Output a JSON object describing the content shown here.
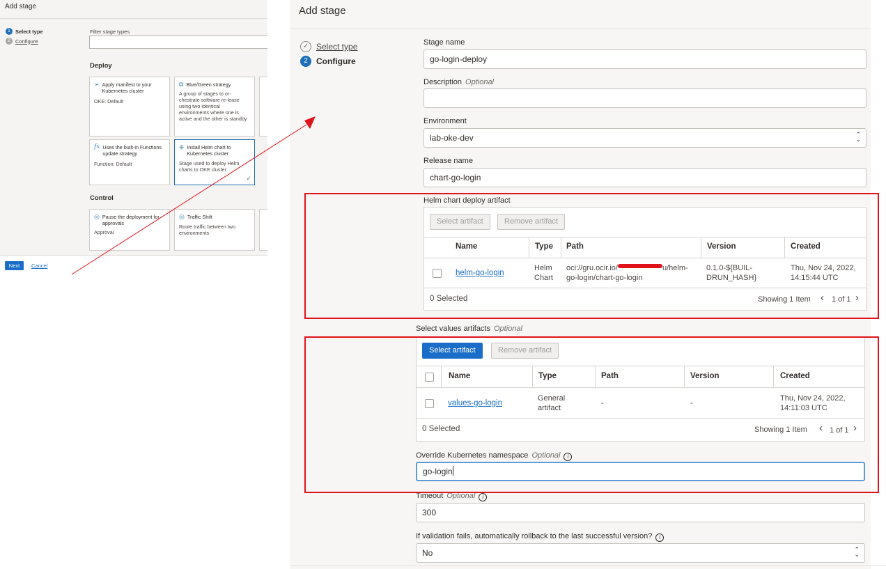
{
  "mini": {
    "title": "Add stage",
    "steps": [
      {
        "num": "1",
        "label": "Select type"
      },
      {
        "num": "2",
        "label": "Configure"
      }
    ],
    "filter_label": "Filter stage types",
    "deploy_heading": "Deploy",
    "control_heading": "Control",
    "cards": [
      {
        "title": "Apply manifest to your Kubernetes cluster",
        "desc": "OKE: Default"
      },
      {
        "title": "Blue/Green strategy",
        "desc": "A group of stages to or-chestrate software re-lease using two identical environments where one is active and the other is standby"
      },
      {
        "title": "Uses the built-in Functions update strategy",
        "desc": "Function: Default"
      },
      {
        "title": "Install Helm chart to Kubernetes cluster",
        "desc": "Stage used to deploy Helm charts to OKE cluster"
      },
      {
        "title": "Pause the deployment for approvals",
        "desc": "Approval"
      },
      {
        "title": "Traffic Shift",
        "desc": "Route traffic between two environments"
      }
    ],
    "next_label": "Next",
    "cancel_label": "Cancel"
  },
  "panel": {
    "title": "Add stage",
    "steps": [
      {
        "num": "",
        "label": "Select type"
      },
      {
        "num": "2",
        "label": "Configure"
      }
    ],
    "stage_name": {
      "label": "Stage name",
      "value": "go-login-deploy"
    },
    "description": {
      "label": "Description",
      "optional": "Optional",
      "value": ""
    },
    "environment": {
      "label": "Environment",
      "value": "lab-oke-dev"
    },
    "release_name": {
      "label": "Release name",
      "value": "chart-go-login"
    },
    "helm_artifact": {
      "label": "Helm chart deploy artifact",
      "select_btn": "Select artifact",
      "remove_btn": "Remove artifact",
      "columns": [
        "Name",
        "Type",
        "Path",
        "Version",
        "Created"
      ],
      "row": {
        "name": "helm-go-login",
        "type": "Helm Chart",
        "path_line1": "oci://gru.ocir.io/",
        "path_line1_end": "u/helm-",
        "path_line2": "go-login/chart-go-login",
        "version": "0.1.0-${BUIL-DRUN_HASH}",
        "created": "Thu, Nov 24, 2022, 14:15:44 UTC"
      },
      "selected": "0 Selected",
      "showing": "Showing 1 Item",
      "page": "1 of 1"
    },
    "values_artifacts": {
      "label": "Select values artifacts",
      "optional": "Optional",
      "select_btn": "Select artifact",
      "remove_btn": "Remove artifact",
      "columns": [
        "Name",
        "Type",
        "Path",
        "Version",
        "Created"
      ],
      "row": {
        "name": "values-go-login",
        "type": "General artifact",
        "path": "-",
        "version": "-",
        "created": "Thu, Nov 24, 2022, 14:11:03 UTC"
      },
      "selected": "0 Selected",
      "showing": "Showing 1 Item",
      "page": "1 of 1"
    },
    "namespace": {
      "label": "Override Kubernetes namespace",
      "optional": "Optional",
      "value": "go-login"
    },
    "timeout": {
      "label": "Timeout",
      "optional": "Optional",
      "value": "300"
    },
    "rollback": {
      "label": "If validation fails, automatically rollback to the last successful version?",
      "value": "No"
    }
  },
  "colors": {
    "accent": "#1a6dc8",
    "annotation": "#e0121a"
  }
}
